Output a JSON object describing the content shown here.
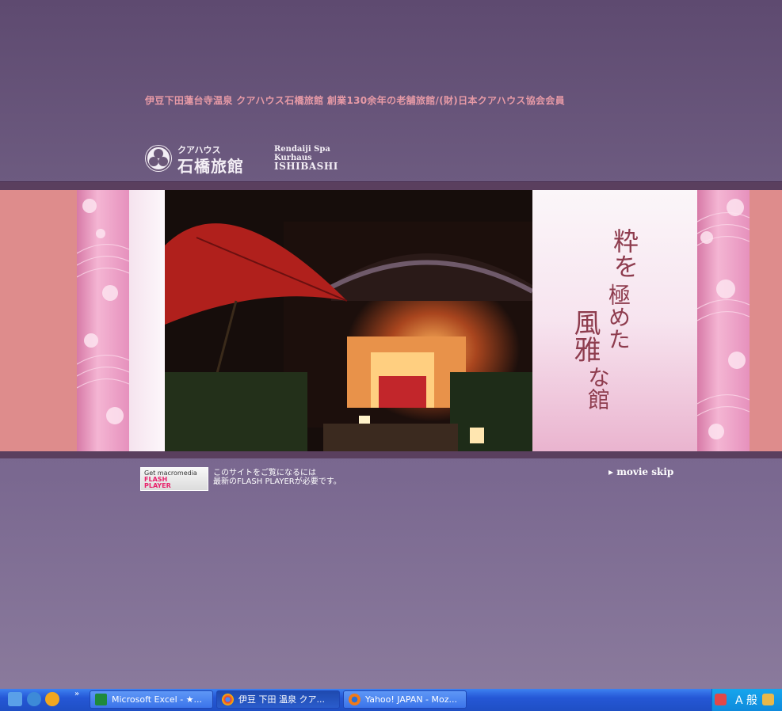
{
  "header": {
    "tagline": "伊豆下田蓮台寺温泉 クアハウス石橋旅館 創業130余年の老舗旅館/(財)日本クアハウス協会会員",
    "logo_small": "クアハウス",
    "logo_big": "石橋旅館",
    "logo_en_1": "Rendaiji Spa",
    "logo_en_2": "Kurhaus",
    "logo_en_3": "ISHIBASHI"
  },
  "banner": {
    "vertical_text": {
      "col1": "粋を",
      "col1b": "極めた",
      "col2": "風雅",
      "col3": "な館"
    }
  },
  "flash": {
    "get": "Get macromedia",
    "line1": "FLASH",
    "line2": "PLAYER",
    "note_1": "このサイトをご覧になるには",
    "note_2": "最新のFLASH PLAYERが必要です。"
  },
  "movie_skip": "▸ movie skip",
  "taskbar": {
    "chevron": "»",
    "tasks": [
      {
        "label": "Microsoft Excel - ★...",
        "icon": "excel-icon"
      },
      {
        "label": "伊豆 下田 温泉 クア...",
        "icon": "chrome-icon"
      },
      {
        "label": "Yahoo! JAPAN - Moz...",
        "icon": "firefox-icon"
      }
    ],
    "ime": "A 般"
  },
  "colors": {
    "tagline": "#e79aa6",
    "banner_pink": "#de8c8c",
    "accent_text": "#8e3c4e",
    "taskbar": "#2557d6"
  }
}
